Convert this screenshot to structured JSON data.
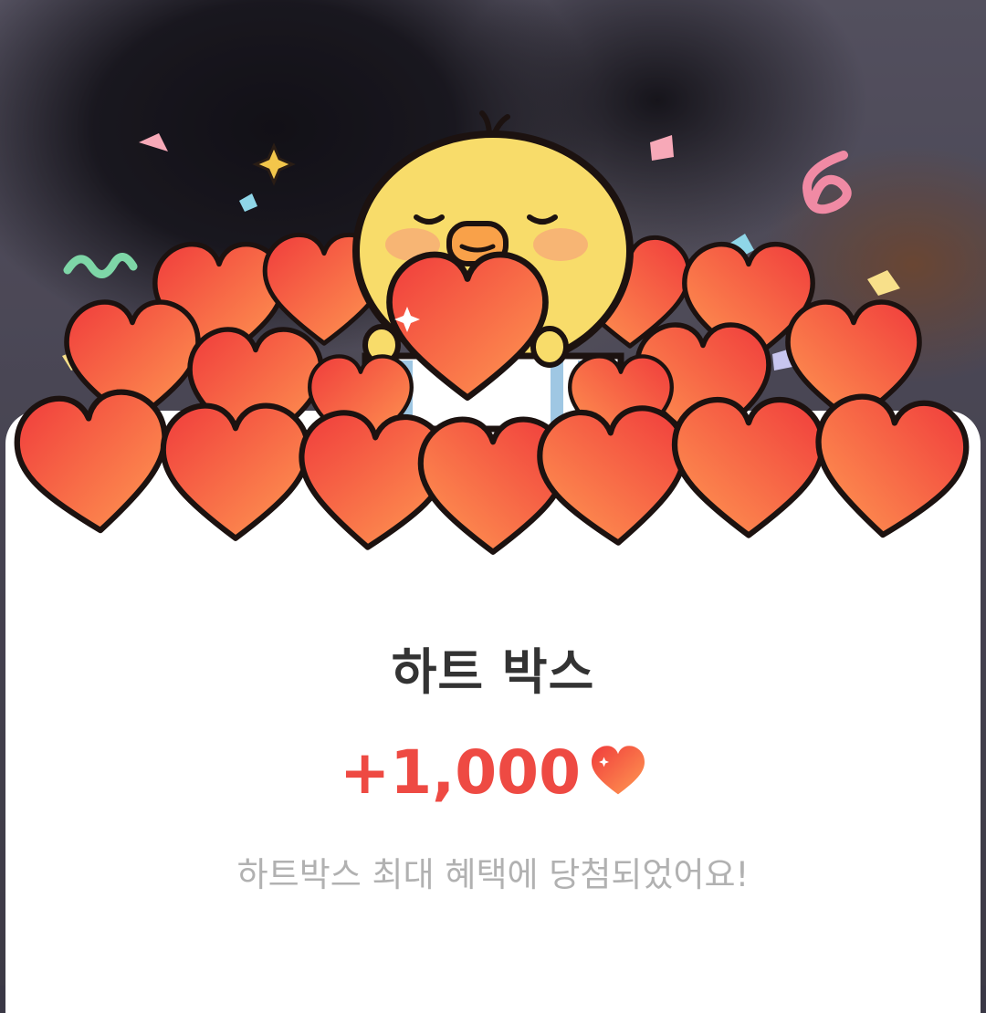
{
  "dialog": {
    "title": "하트 박스",
    "reward_amount": "+1,000",
    "message": "하트박스 최대 혜택에 당첨되었어요!"
  },
  "icons": {
    "illustration": "chick-holding-heart-in-heart-box-illustration",
    "reward": "heart-icon"
  },
  "colors": {
    "accent": "#ee4a43",
    "title": "#333333",
    "message": "#b1b1b1",
    "heart_light": "#ff8e4d",
    "heart_dark": "#f03c3c",
    "chick": "#f8dc6a"
  }
}
